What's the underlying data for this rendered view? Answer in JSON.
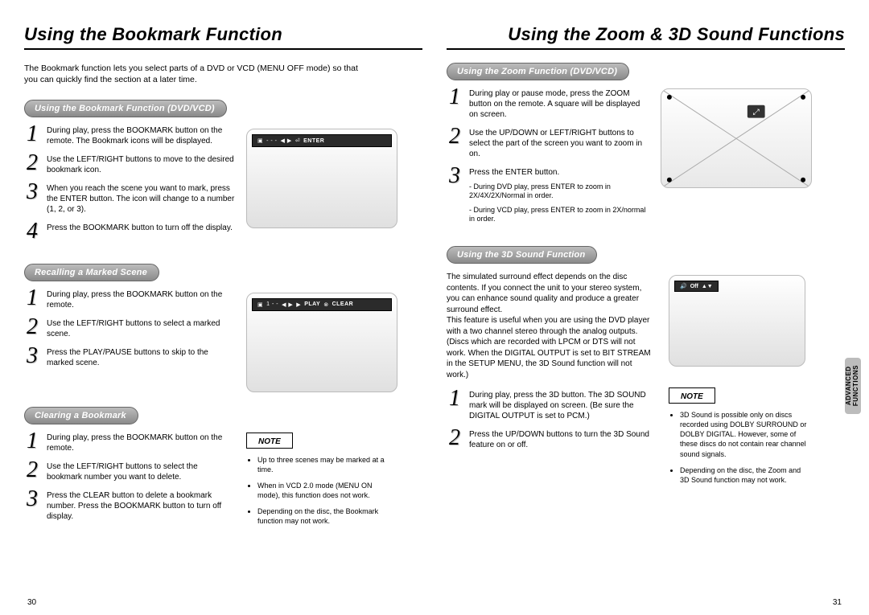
{
  "left": {
    "title": "Using the Bookmark Function",
    "intro": "The Bookmark function lets you select parts of a DVD or VCD (MENU OFF mode) so that you can quickly find the section at a later time.",
    "sec1": {
      "pill": "Using the Bookmark Function (DVD/VCD)",
      "osd": {
        "bm": "▣",
        "dashes": "-  -  -",
        "arrows": "◀ ▶",
        "entIcon": "⏎",
        "entText": "ENTER"
      },
      "s1": "During play, press the BOOKMARK button on the remote. The Bookmark icons will be displayed.",
      "s2": "Use the LEFT/RIGHT buttons to move to the desired bookmark icon.",
      "s3": "When you reach the scene you want to mark, press the ENTER button. The icon will change to a number (1, 2, or 3).",
      "s4": "Press the BOOKMARK button to turn off the display."
    },
    "sec2": {
      "pill": "Recalling a Marked Scene",
      "osd": {
        "bm": "▣",
        "one": "1  -  -",
        "arrows": "◀ ▶",
        "playIcon": "▶",
        "playText": "PLAY",
        "clearIcon": "⊗",
        "clearText": "CLEAR"
      },
      "s1": "During play, press the BOOKMARK button on the remote.",
      "s2": "Use the LEFT/RIGHT buttons to select a marked scene.",
      "s3": "Press the PLAY/PAUSE buttons to skip to the marked scene."
    },
    "sec3": {
      "pill": "Clearing a Bookmark",
      "s1": "During play, press the BOOKMARK button on the remote.",
      "s2": "Use the LEFT/RIGHT buttons to select the bookmark number you want to delete.",
      "s3": "Press the CLEAR button to delete a bookmark number. Press the BOOKMARK button to turn off display.",
      "noteLabel": "NOTE",
      "n1": "Up to three scenes may be marked at a time.",
      "n2": "When in VCD 2.0 mode (MENU ON mode), this function does not work.",
      "n3": "Depending on the disc, the Bookmark function may not work."
    },
    "pageNum": "30"
  },
  "right": {
    "title": "Using the Zoom & 3D Sound Functions",
    "sec1": {
      "pill": "Using the Zoom Function (DVD/VCD)",
      "s1": "During play or pause mode, press the ZOOM button on the remote. A square will be displayed on screen.",
      "s2": "Use the UP/DOWN or LEFT/RIGHT buttons to select the part of the screen you want to zoom in on.",
      "s3": "Press the ENTER button.",
      "sub1": "- During DVD play, press ENTER to zoom in 2X/4X/2X/Normal in order.",
      "sub2": "- During VCD play, press ENTER to zoom in 2X/normal in order.",
      "zoomIcon": "⤢"
    },
    "sec2": {
      "pill": "Using the 3D Sound Function",
      "para": "The simulated surround effect depends on the disc contents. If you connect the unit to your stereo system, you can enhance sound quality and produce a greater surround effect.\nThis feature is useful when you are using the DVD player with a two channel stereo through the analog outputs.\n(Discs which are recorded with LPCM or DTS will not work. When the DIGITAL OUTPUT is set to BIT STREAM in the SETUP MENU, the 3D Sound function will not work.)",
      "osd": {
        "speaker": "🔊",
        "offText": "Off",
        "updown": "▲▼"
      },
      "s1": "During play, press the 3D button. The 3D SOUND mark will be displayed on screen. (Be sure the DIGITAL OUTPUT is set to PCM.)",
      "s2": "Press the UP/DOWN buttons to turn the 3D Sound feature on or off.",
      "noteLabel": "NOTE",
      "n1": "3D Sound is possible only on discs recorded using DOLBY SURROUND or DOLBY DIGITAL. However, some of these discs do not contain rear channel sound signals.",
      "n2": "Depending on the disc, the Zoom and 3D Sound function may not work."
    },
    "sideTab": "ADVANCED\nFUNCTIONS",
    "pageNum": "31"
  }
}
